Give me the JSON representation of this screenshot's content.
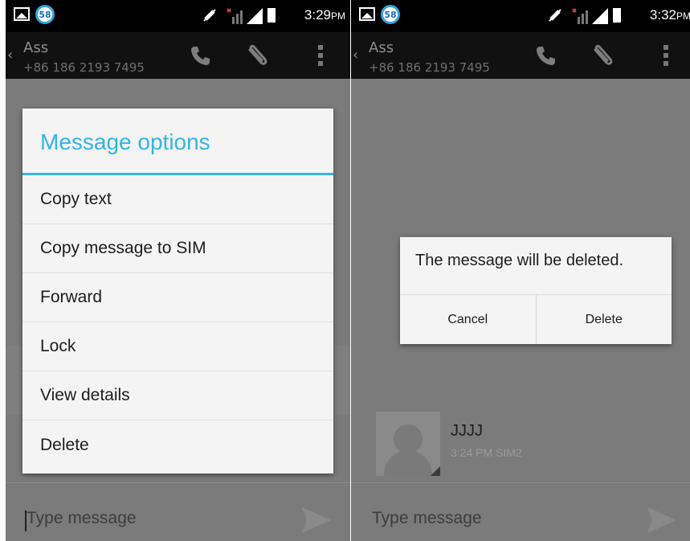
{
  "colors": {
    "accent": "#33b5e5",
    "dim_background": "#7b7b7b",
    "status_bar": "#000000",
    "action_bar": "#111111",
    "dialog_background": "#f4f4f4"
  },
  "left_screen": {
    "status_bar": {
      "notification_count": "58",
      "time": "3:29",
      "time_suffix": "PM",
      "icons": [
        "image-icon",
        "mute-icon",
        "no-sim-icon",
        "signal-icon",
        "battery-icon"
      ]
    },
    "action_bar": {
      "contact_name": "Ass",
      "contact_number": "+86 186 2193 7495",
      "icons": [
        "back-chevron-icon",
        "call-icon",
        "attach-icon",
        "overflow-menu-icon"
      ]
    },
    "dialog": {
      "title": "Message options",
      "items": [
        {
          "label": "Copy text"
        },
        {
          "label": "Copy message to SIM"
        },
        {
          "label": "Forward"
        },
        {
          "label": "Lock"
        },
        {
          "label": "View details"
        },
        {
          "label": "Delete"
        }
      ]
    },
    "compose": {
      "placeholder": "Type message",
      "send_icon": "send-icon"
    }
  },
  "right_screen": {
    "status_bar": {
      "notification_count": "58",
      "time": "3:32",
      "time_suffix": "PM",
      "icons": [
        "image-icon",
        "mute-icon",
        "no-sim-icon",
        "signal-icon",
        "battery-icon"
      ]
    },
    "action_bar": {
      "contact_name": "Ass",
      "contact_number": "+86 186 2193 7495",
      "icons": [
        "back-chevron-icon",
        "call-icon",
        "attach-icon",
        "overflow-menu-icon"
      ]
    },
    "dialog": {
      "message": "The message will be deleted.",
      "cancel_label": "Cancel",
      "delete_label": "Delete"
    },
    "message": {
      "sender": "JJJJ",
      "meta": "3:24 PM SIM2"
    },
    "compose": {
      "placeholder": "Type message",
      "send_icon": "send-icon"
    }
  }
}
